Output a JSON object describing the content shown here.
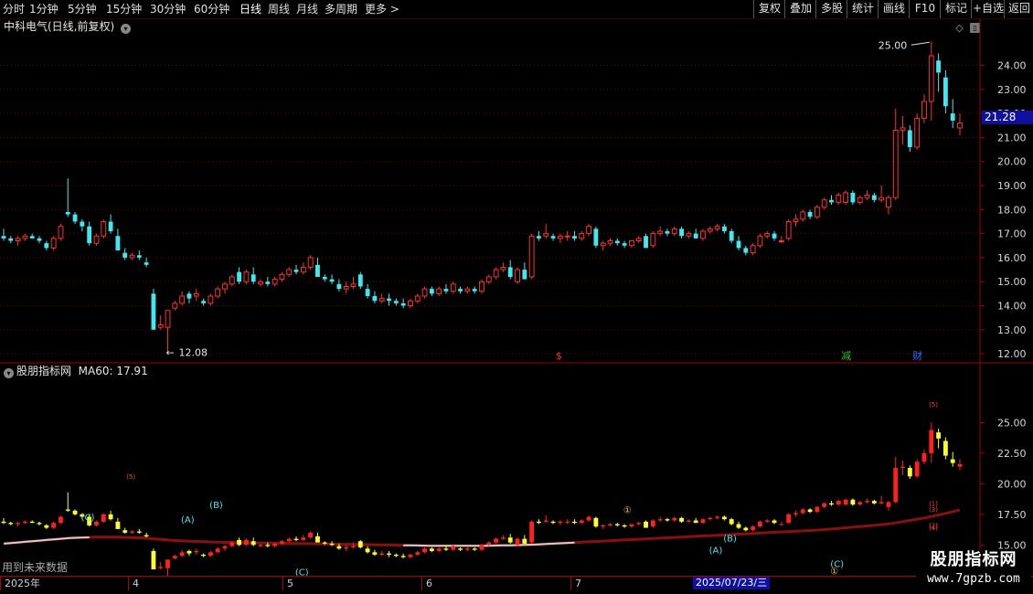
{
  "toolbar": {
    "periods": [
      "分时",
      "1分钟",
      "5分钟",
      "15分钟",
      "30分钟",
      "60分钟",
      "日线",
      "周线",
      "月线",
      "多周期",
      "更多 >"
    ],
    "active_period": "日线",
    "right_buttons": [
      "复权",
      "叠加",
      "多股",
      "统计",
      "画线",
      "F10",
      "标记",
      "+自选",
      "返回"
    ]
  },
  "stock": {
    "title": "中科电气(日线,前复权)",
    "current_price": "21.28",
    "high_label": "25.00",
    "low_label": "12.08"
  },
  "main_axis": {
    "ticks": [
      "24.00",
      "23.00",
      "22.00",
      "21.00",
      "20.00",
      "19.00",
      "18.00",
      "17.00",
      "16.00",
      "15.00",
      "14.00",
      "13.00",
      "12.00"
    ]
  },
  "event_markers": [
    {
      "label": "$",
      "color": "#ff3030"
    },
    {
      "label": "减",
      "color": "#30c030"
    },
    {
      "label": "财",
      "color": "#3070ff"
    }
  ],
  "sub": {
    "title": "股朋指标网",
    "ma_label": "MA60: 17.91",
    "ticks": [
      "25.00",
      "22.50",
      "20.00",
      "17.50",
      "15.00"
    ],
    "footnote": "用到未来数据"
  },
  "wave_labels": [
    "(C)",
    "(A)",
    "(B)",
    "(B)",
    "(A)",
    "(C)",
    "(C)",
    "①",
    "①",
    "(5)",
    "(5)",
    "(1)",
    "(2)",
    "(3)",
    "(4)"
  ],
  "time_axis": {
    "labels": [
      "2025年",
      "4",
      "5",
      "6",
      "7"
    ],
    "cursor_date": "2025/07/23/三"
  },
  "watermark": {
    "name": "股朋指标网",
    "url": "www.7gpzb.com"
  },
  "colors": {
    "up": "#ff3030",
    "down": "#40e8f0",
    "grid": "#6a0000",
    "sub_up": "#ff2020",
    "sub_down": "#ffff30"
  },
  "chart_data": {
    "type": "candlestick",
    "ylim": [
      11.7,
      25.2
    ],
    "candles": [
      [
        16.9,
        17.2,
        16.7,
        16.8
      ],
      [
        16.8,
        16.9,
        16.6,
        16.7
      ],
      [
        16.7,
        16.9,
        16.5,
        16.8
      ],
      [
        16.8,
        17.0,
        16.7,
        16.9
      ],
      [
        16.9,
        17.0,
        16.8,
        16.8
      ],
      [
        16.8,
        16.9,
        16.6,
        16.7
      ],
      [
        16.6,
        16.7,
        16.3,
        16.4
      ],
      [
        16.4,
        16.9,
        16.3,
        16.8
      ],
      [
        16.8,
        17.4,
        16.7,
        17.3
      ],
      [
        17.9,
        19.3,
        17.7,
        17.8
      ],
      [
        17.8,
        17.9,
        17.4,
        17.5
      ],
      [
        17.5,
        17.6,
        17.1,
        17.3
      ],
      [
        17.3,
        17.5,
        16.5,
        16.6
      ],
      [
        16.6,
        17.0,
        16.5,
        16.9
      ],
      [
        16.9,
        17.6,
        16.8,
        17.5
      ],
      [
        17.5,
        17.8,
        17.0,
        17.1
      ],
      [
        16.9,
        17.2,
        16.3,
        16.3
      ],
      [
        16.2,
        16.4,
        15.9,
        16.0
      ],
      [
        16.0,
        16.2,
        15.9,
        16.1
      ],
      [
        16.1,
        16.3,
        15.9,
        16.0
      ],
      [
        15.8,
        16.0,
        15.6,
        15.7
      ],
      [
        14.5,
        14.7,
        13.0,
        13.0
      ],
      [
        13.1,
        13.6,
        13.0,
        13.2
      ],
      [
        13.1,
        13.8,
        12.1,
        13.8
      ],
      [
        13.9,
        14.2,
        13.8,
        14.1
      ],
      [
        14.1,
        14.6,
        14.0,
        14.4
      ],
      [
        14.5,
        14.6,
        14.1,
        14.3
      ],
      [
        14.4,
        14.7,
        14.2,
        14.5
      ],
      [
        14.2,
        14.3,
        14.0,
        14.1
      ],
      [
        14.1,
        14.5,
        14.0,
        14.4
      ],
      [
        14.4,
        14.8,
        14.3,
        14.7
      ],
      [
        14.7,
        15.0,
        14.5,
        14.9
      ],
      [
        14.9,
        15.3,
        14.8,
        15.2
      ],
      [
        15.4,
        15.6,
        14.9,
        15.0
      ],
      [
        15.0,
        15.5,
        14.9,
        15.4
      ],
      [
        15.3,
        15.6,
        14.9,
        15.0
      ],
      [
        14.9,
        15.1,
        14.8,
        15.0
      ],
      [
        15.0,
        15.2,
        14.8,
        14.9
      ],
      [
        14.9,
        15.2,
        14.8,
        15.1
      ],
      [
        15.1,
        15.4,
        15.0,
        15.3
      ],
      [
        15.3,
        15.6,
        15.2,
        15.5
      ],
      [
        15.5,
        15.7,
        15.3,
        15.4
      ],
      [
        15.4,
        15.8,
        15.3,
        15.6
      ],
      [
        15.6,
        16.1,
        15.5,
        16.0
      ],
      [
        15.7,
        16.0,
        15.2,
        15.2
      ],
      [
        15.2,
        15.3,
        15.0,
        15.1
      ],
      [
        15.1,
        15.3,
        14.9,
        15.0
      ],
      [
        14.9,
        15.1,
        14.6,
        14.7
      ],
      [
        14.7,
        15.0,
        14.5,
        14.8
      ],
      [
        14.8,
        15.2,
        14.7,
        14.9
      ],
      [
        15.3,
        15.4,
        14.7,
        14.8
      ],
      [
        14.7,
        14.9,
        14.3,
        14.4
      ],
      [
        14.4,
        14.6,
        14.1,
        14.2
      ],
      [
        14.2,
        14.5,
        14.1,
        14.3
      ],
      [
        14.3,
        14.5,
        14.0,
        14.2
      ],
      [
        14.2,
        14.3,
        14.0,
        14.1
      ],
      [
        14.1,
        14.3,
        13.9,
        14.0
      ],
      [
        14.0,
        14.3,
        13.9,
        14.2
      ],
      [
        14.2,
        14.5,
        14.1,
        14.4
      ],
      [
        14.4,
        14.8,
        14.3,
        14.7
      ],
      [
        14.7,
        14.8,
        14.4,
        14.5
      ],
      [
        14.5,
        14.8,
        14.4,
        14.7
      ],
      [
        14.7,
        14.9,
        14.5,
        14.6
      ],
      [
        14.6,
        15.0,
        14.5,
        14.9
      ],
      [
        14.7,
        14.8,
        14.5,
        14.6
      ],
      [
        14.6,
        14.8,
        14.5,
        14.7
      ],
      [
        14.7,
        14.8,
        14.5,
        14.6
      ],
      [
        14.6,
        15.1,
        14.5,
        15.0
      ],
      [
        15.0,
        15.3,
        14.9,
        15.2
      ],
      [
        15.2,
        15.6,
        15.1,
        15.5
      ],
      [
        15.5,
        15.8,
        15.4,
        15.6
      ],
      [
        15.6,
        15.9,
        15.1,
        15.2
      ],
      [
        15.0,
        15.6,
        14.9,
        15.5
      ],
      [
        15.5,
        15.8,
        15.1,
        15.1
      ],
      [
        15.2,
        17.0,
        15.1,
        16.9
      ],
      [
        16.9,
        17.1,
        16.7,
        16.8
      ],
      [
        16.9,
        17.4,
        16.8,
        17.0
      ],
      [
        16.9,
        17.0,
        16.7,
        16.8
      ],
      [
        16.8,
        17.0,
        16.6,
        16.9
      ],
      [
        16.9,
        17.1,
        16.7,
        16.9
      ],
      [
        16.9,
        17.1,
        16.7,
        16.8
      ],
      [
        16.8,
        17.1,
        16.7,
        17.0
      ],
      [
        17.0,
        17.4,
        16.9,
        17.3
      ],
      [
        17.2,
        17.3,
        16.4,
        16.5
      ],
      [
        16.5,
        16.7,
        16.3,
        16.6
      ],
      [
        16.6,
        16.8,
        16.5,
        16.7
      ],
      [
        16.7,
        16.8,
        16.5,
        16.6
      ],
      [
        16.6,
        16.7,
        16.4,
        16.5
      ],
      [
        16.5,
        16.7,
        16.4,
        16.7
      ],
      [
        16.7,
        16.9,
        16.6,
        16.8
      ],
      [
        16.9,
        17.0,
        16.4,
        16.4
      ],
      [
        16.5,
        17.1,
        16.4,
        17.0
      ],
      [
        17.0,
        17.3,
        16.9,
        17.1
      ],
      [
        17.1,
        17.2,
        16.9,
        17.0
      ],
      [
        17.0,
        17.3,
        16.9,
        17.2
      ],
      [
        17.2,
        17.3,
        16.8,
        16.9
      ],
      [
        16.9,
        17.1,
        16.8,
        17.0
      ],
      [
        17.0,
        17.2,
        16.8,
        16.8
      ],
      [
        16.8,
        17.2,
        16.7,
        17.1
      ],
      [
        17.1,
        17.3,
        17.0,
        17.2
      ],
      [
        17.2,
        17.4,
        17.1,
        17.3
      ],
      [
        17.3,
        17.4,
        17.0,
        17.1
      ],
      [
        17.1,
        17.2,
        16.6,
        16.7
      ],
      [
        16.7,
        16.9,
        16.3,
        16.4
      ],
      [
        16.4,
        16.5,
        16.1,
        16.2
      ],
      [
        16.2,
        16.6,
        16.1,
        16.5
      ],
      [
        16.5,
        17.0,
        16.4,
        16.9
      ],
      [
        16.9,
        17.1,
        16.8,
        17.0
      ],
      [
        17.0,
        17.1,
        16.7,
        16.8
      ],
      [
        16.7,
        16.9,
        16.6,
        16.7
      ],
      [
        16.8,
        17.6,
        16.7,
        17.5
      ],
      [
        17.5,
        17.8,
        17.3,
        17.6
      ],
      [
        17.6,
        18.0,
        17.5,
        17.9
      ],
      [
        17.9,
        18.0,
        17.6,
        17.7
      ],
      [
        17.7,
        18.2,
        17.6,
        18.1
      ],
      [
        18.1,
        18.5,
        18.0,
        18.4
      ],
      [
        18.4,
        18.6,
        18.2,
        18.3
      ],
      [
        18.3,
        18.7,
        18.2,
        18.6
      ],
      [
        18.3,
        18.8,
        18.2,
        18.7
      ],
      [
        18.7,
        18.8,
        18.2,
        18.3
      ],
      [
        18.3,
        18.6,
        18.2,
        18.5
      ],
      [
        18.5,
        18.8,
        18.4,
        18.6
      ],
      [
        18.6,
        18.7,
        18.3,
        18.4
      ],
      [
        18.4,
        19.0,
        18.3,
        18.5
      ],
      [
        18.1,
        18.6,
        17.8,
        18.5
      ],
      [
        18.5,
        22.2,
        18.4,
        21.3
      ],
      [
        21.3,
        21.9,
        20.7,
        21.4
      ],
      [
        21.3,
        21.5,
        20.4,
        20.6
      ],
      [
        20.6,
        22.0,
        20.5,
        21.8
      ],
      [
        21.8,
        22.8,
        21.6,
        22.5
      ],
      [
        22.5,
        25.0,
        21.7,
        24.4
      ],
      [
        24.2,
        24.5,
        22.9,
        23.7
      ],
      [
        23.5,
        23.8,
        22.0,
        22.3
      ],
      [
        22.0,
        22.6,
        21.4,
        21.7
      ],
      [
        21.4,
        22.0,
        21.1,
        21.6
      ]
    ],
    "ma60": [
      15.1,
      15.15,
      15.2,
      15.25,
      15.3,
      15.35,
      15.4,
      15.45,
      15.5,
      15.55,
      15.58,
      15.6,
      15.62,
      15.63,
      15.64,
      15.64,
      15.63,
      15.62,
      15.6,
      15.58,
      15.55,
      15.5,
      15.45,
      15.4,
      15.36,
      15.33,
      15.3,
      15.28,
      15.26,
      15.24,
      15.22,
      15.21,
      15.2,
      15.19,
      15.18,
      15.17,
      15.16,
      15.15,
      15.14,
      15.13,
      15.12,
      15.11,
      15.1,
      15.1,
      15.09,
      15.08,
      15.07,
      15.06,
      15.05,
      15.04,
      15.03,
      15.02,
      15.01,
      15.0,
      14.99,
      14.98,
      14.97,
      14.96,
      14.95,
      14.94,
      14.93,
      14.93,
      14.92,
      14.92,
      14.92,
      14.92,
      14.93,
      14.93,
      14.94,
      14.95,
      14.96,
      14.97,
      14.98,
      15.0,
      15.02,
      15.04,
      15.07,
      15.1,
      15.13,
      15.16,
      15.19,
      15.22,
      15.25,
      15.28,
      15.31,
      15.34,
      15.37,
      15.4,
      15.43,
      15.46,
      15.49,
      15.52,
      15.55,
      15.58,
      15.61,
      15.64,
      15.67,
      15.7,
      15.73,
      15.76,
      15.79,
      15.82,
      15.85,
      15.88,
      15.91,
      15.94,
      15.97,
      16.0,
      16.03,
      16.06,
      16.09,
      16.12,
      16.15,
      16.18,
      16.21,
      16.25,
      16.3,
      16.35,
      16.4,
      16.45,
      16.5,
      16.55,
      16.6,
      16.66,
      16.72,
      16.8,
      16.9,
      17.0,
      17.1,
      17.2,
      17.32,
      17.45,
      17.58,
      17.72,
      17.86
    ]
  }
}
